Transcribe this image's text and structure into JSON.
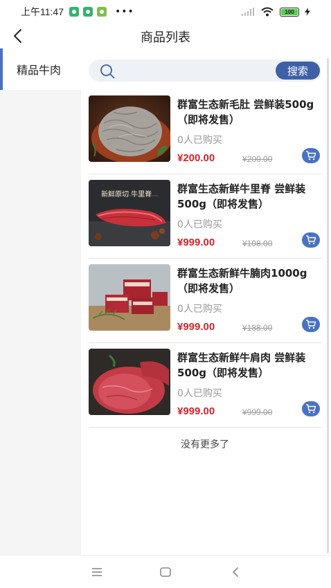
{
  "status_bar": {
    "time": "上午11:47",
    "dots": "•••",
    "battery": "100",
    "app_icon_colors": [
      "#2fb56a",
      "#2fb56a",
      "#7cc04a"
    ]
  },
  "nav": {
    "title": "商品列表",
    "back_icon": "chevron-left-icon"
  },
  "sidebar": {
    "items": [
      {
        "label": "精品牛肉",
        "active": true
      }
    ]
  },
  "search": {
    "placeholder": "",
    "button_label": "搜索"
  },
  "products": [
    {
      "title": "群富生态新毛肚 尝鲜装500g（即将发售）",
      "sold": "0人已购买",
      "price": "¥200.00",
      "original_price": "¥200.00"
    },
    {
      "title": "群富生态新鲜牛里脊 尝鲜装 500g（即将发售）",
      "sold": "0人已购买",
      "price": "¥999.00",
      "original_price": "¥108.00",
      "image_caption": "新鲜原切 牛里脊"
    },
    {
      "title": "群富生态新鲜牛腩肉1000g（即将发售）",
      "sold": "0人已购买",
      "price": "¥999.00",
      "original_price": "¥188.00"
    },
    {
      "title": "群富生态新鲜牛肩肉 尝鲜装 500g（即将发售）",
      "sold": "0人已购买",
      "price": "¥999.00",
      "original_price": "¥999.00"
    }
  ],
  "list_footer": "没有更多了",
  "colors": {
    "accent": "#3e60a6",
    "price": "#d0252c",
    "sidebar_bg": "#f5f5f5"
  }
}
